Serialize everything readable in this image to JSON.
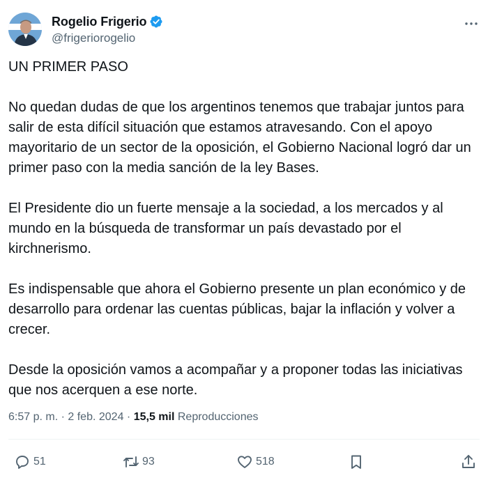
{
  "author": {
    "display_name": "Rogelio Frigerio",
    "handle": "@frigeriorogelio",
    "verified": true,
    "verified_color": "#1d9bf0"
  },
  "tweet": {
    "paragraphs": [
      "UN PRIMER PASO",
      "No quedan dudas de que los argentinos tenemos que trabajar juntos para salir de esta difícil situación que estamos atravesando. Con el apoyo mayoritario de un sector de la oposición, el Gobierno Nacional logró dar un primer paso con la media sanción de la ley Bases.",
      "El Presidente dio un fuerte mensaje a la sociedad, a los mercados y al mundo en la búsqueda de transformar un país devastado por el kirchnerismo.",
      "Es indispensable que ahora el Gobierno presente un plan económico y de desarrollo para ordenar las cuentas públicas, bajar la inflación y volver a crecer.",
      "Desde la oposición vamos a acompañar y a proponer todas las iniciativas que nos acerquen a ese norte."
    ],
    "time": "6:57 p. m.",
    "date": "2 feb. 2024",
    "separator": "·",
    "views_count": "15,5 mil",
    "views_label": "Reproducciones"
  },
  "actions": {
    "replies": "51",
    "reposts": "93",
    "likes": "518"
  },
  "icons": {
    "more": "more-icon",
    "reply": "reply-icon",
    "repost": "repost-icon",
    "like": "heart-icon",
    "bookmark": "bookmark-icon",
    "share": "share-icon",
    "verified": "verified-badge-icon"
  },
  "colors": {
    "text_primary": "#0f1419",
    "text_secondary": "#536471",
    "divider": "#eff3f4",
    "accent": "#1d9bf0"
  }
}
